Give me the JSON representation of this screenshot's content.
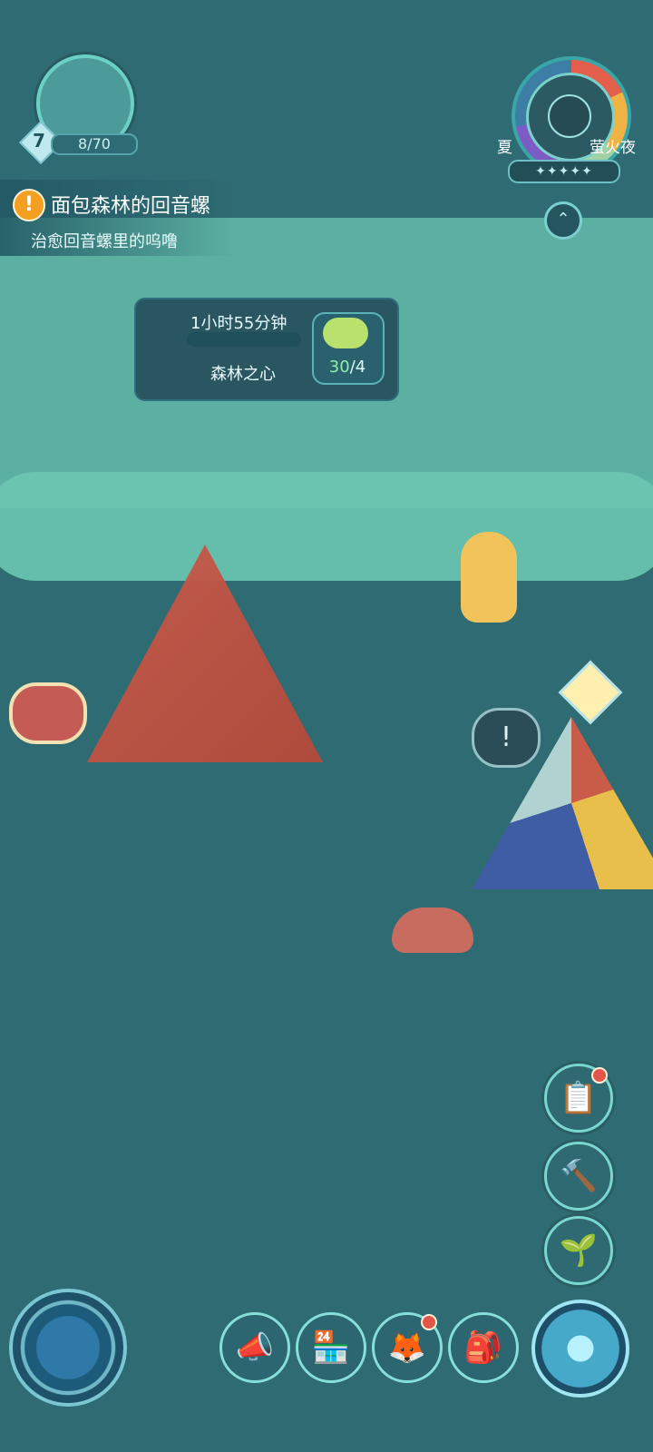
{
  "player": {
    "level": "7",
    "xp_text": "8/70"
  },
  "quest": {
    "title": "面包森林的回音螺",
    "subtitle": "治愈回音螺里的呜噜",
    "icon": "exclamation-icon"
  },
  "season": {
    "left_label": "夏",
    "right_label": "萤火夜",
    "stars": "✦✦✦✦✦",
    "expand_icon": "chevron-up-icon"
  },
  "timer_panel": {
    "time_left": "1小时55分钟",
    "location": "森林之心",
    "progress": 0.0,
    "reward_count_current": "30",
    "reward_count_target": "/4"
  },
  "right_buttons": {
    "tasks_icon": "clipboard-icon",
    "events_icon": "hammer-icon",
    "plant_icon": "sprout-icon"
  },
  "bottom_bar": {
    "compass_icon": "compass-icon",
    "announce_icon": "megaphone-icon",
    "shop_icon": "shop-icon",
    "friends_icon": "fox-icon",
    "bag_icon": "backpack-icon",
    "travel_icon": "navigation-orb-icon"
  }
}
